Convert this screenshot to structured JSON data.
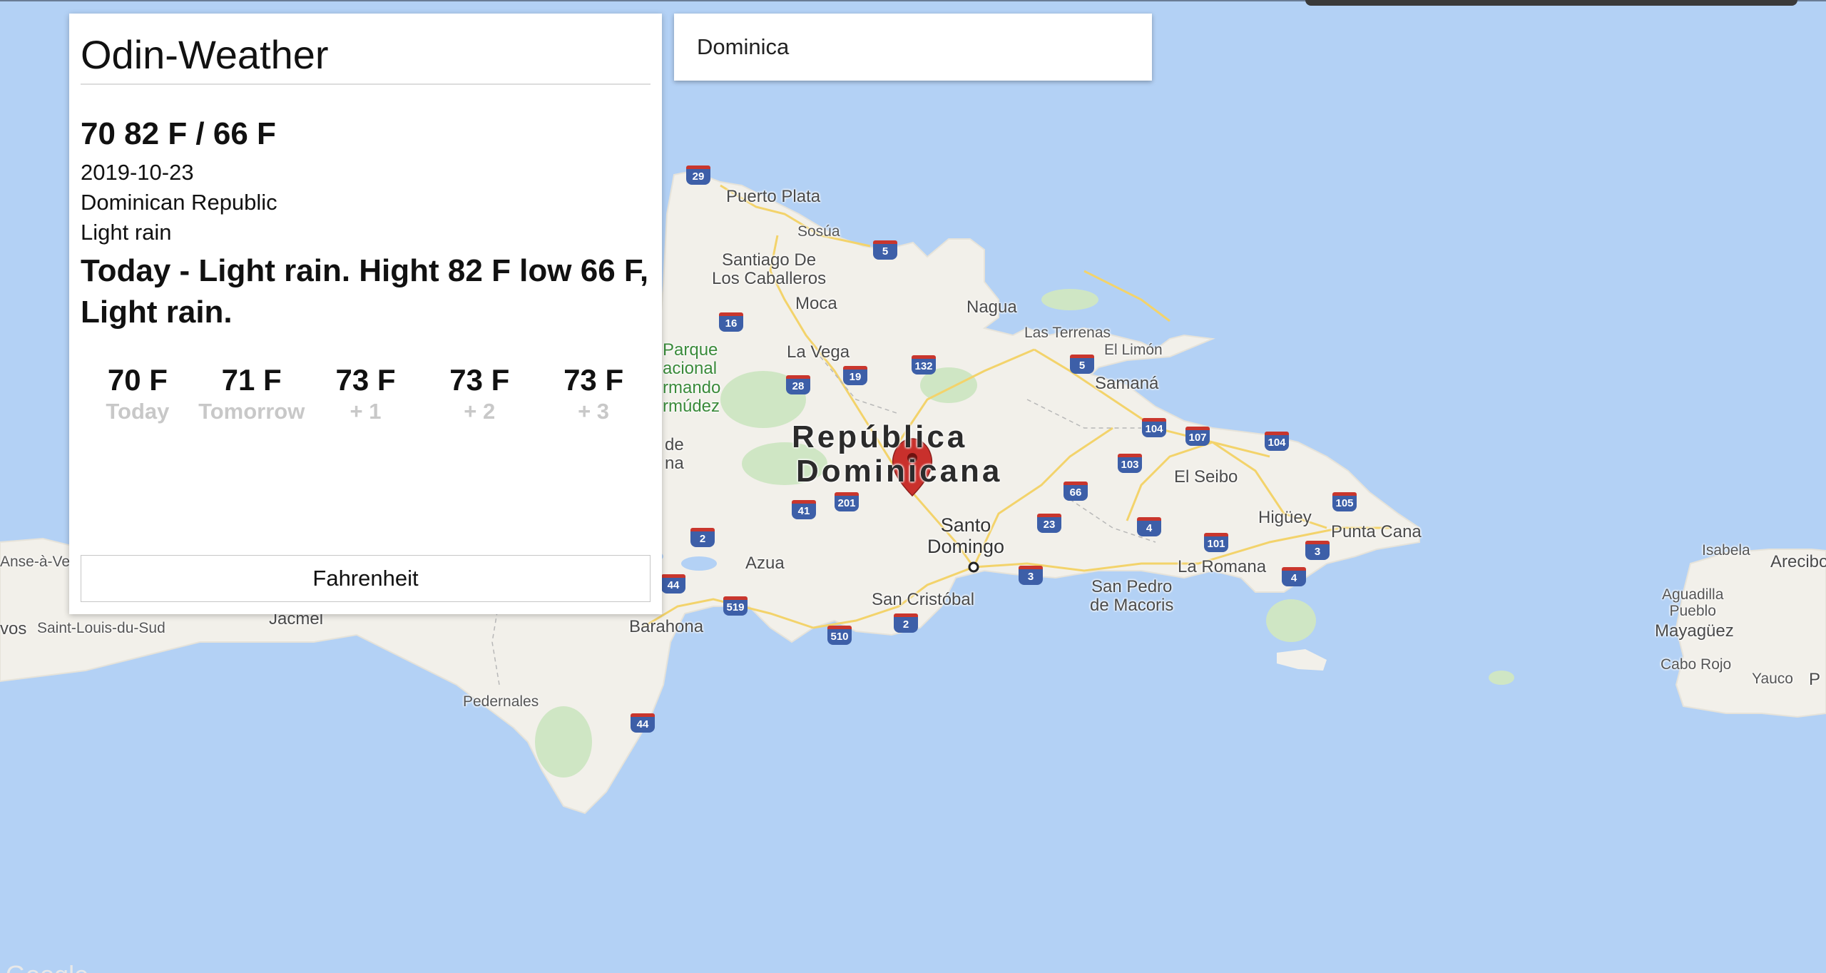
{
  "app": {
    "title": "Odin-Weather"
  },
  "search": {
    "value": "Dominica",
    "placeholder": ""
  },
  "weather": {
    "summary": "70 82 F / 66 F",
    "date": "2019-10-23",
    "country": "Dominican Republic",
    "condition": "Light rain",
    "forecast_text": "Today - Light rain. Hight 82 F low 66 F, Light rain.",
    "days": [
      {
        "temp": "70 F",
        "label": "Today"
      },
      {
        "temp": "71 F",
        "label": "Tomorrow"
      },
      {
        "temp": "73 F",
        "label": "+ 1"
      },
      {
        "temp": "73 F",
        "label": "+ 2"
      },
      {
        "temp": "73 F",
        "label": "+ 3"
      }
    ],
    "unit_button_label": "Fahrenheit"
  },
  "map": {
    "country_label_line1": "República",
    "country_label_line2": "Dominicana",
    "marker_color": "#c9302c",
    "water_color": "#b3d1f5",
    "land_color": "#f2f0ea",
    "attribution": "Google",
    "labels": {
      "puerto_plata": "Puerto Plata",
      "sosua": "Sosúa",
      "santiago": "Santiago De\nLos Caballeros",
      "moca": "Moca",
      "nagua": "Nagua",
      "las_terrenas": "Las Terrenas",
      "el_limon": "El Limón",
      "samana": "Samaná",
      "la_vega": "La Vega",
      "parque": "Parque\nacional\nrmando\nrmúdez",
      "de": "de\nna",
      "santo_domingo": "Santo\nDomingo",
      "el_seibo": "El Seibo",
      "higuey": "Higüey",
      "punta_cana": "Punta Cana",
      "la_romana": "La Romana",
      "san_pedro": "San Pedro\nde Macoris",
      "san_cristobal": "San Cristóbal",
      "azua": "Azua",
      "barahona": "Barahona",
      "pedernales": "Pedernales",
      "jacmel": "Jacmel",
      "saint_louis": "Saint-Louis-du-Sud",
      "anse": "Anse-à-Ve",
      "vos": "vos",
      "isabela": "Isabela",
      "arecibo": "Arecibo",
      "aguadilla": "Aguadilla\nPueblo",
      "mayaguez": "Mayagüez",
      "cabo_rojo": "Cabo Rojo",
      "yauco": "Yauco",
      "p": "P"
    },
    "shields": [
      "29",
      "5",
      "16",
      "28",
      "19",
      "132",
      "5",
      "104",
      "107",
      "104",
      "103",
      "66",
      "201",
      "41",
      "2",
      "23",
      "4",
      "101",
      "105",
      "3",
      "4",
      "3",
      "44",
      "519",
      "510",
      "2",
      "44"
    ]
  }
}
